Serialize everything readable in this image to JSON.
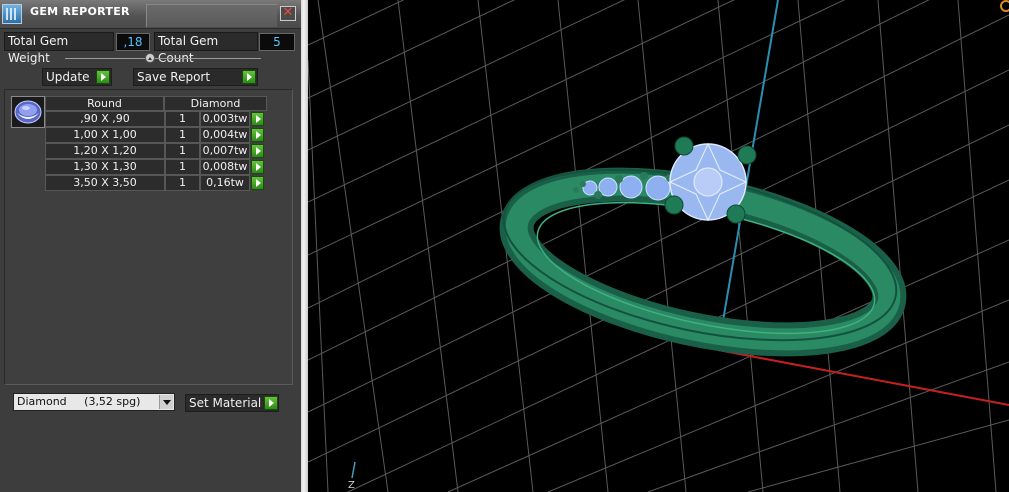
{
  "window": {
    "title": "GEM REPORTER",
    "close_glyph": "✕"
  },
  "totals": {
    "weight_label": "Total Gem Weight",
    "weight_value": ",18",
    "count_label": "Total Gem Count",
    "count_value": "5"
  },
  "actions": {
    "update_label": "Update",
    "save_label": "Save Report"
  },
  "gem_table": {
    "thumbnail_icon": "round-gem-icon",
    "headers": {
      "shape": "Round",
      "material": "Diamond"
    },
    "rows": [
      {
        "size": ",90 X ,90",
        "qty": "1",
        "weight": "0,003tw"
      },
      {
        "size": "1,00 X 1,00",
        "qty": "1",
        "weight": "0,004tw"
      },
      {
        "size": "1,20 X 1,20",
        "qty": "1",
        "weight": "0,007tw"
      },
      {
        "size": "1,30 X 1,30",
        "qty": "1",
        "weight": "0,008tw"
      },
      {
        "size": "3,50 X 3,50",
        "qty": "1",
        "weight": "0,16tw"
      }
    ]
  },
  "material": {
    "selected": "Diamond     (3,52 spg)",
    "set_label": "Set Material"
  },
  "viewport": {
    "axis_label": "Z"
  },
  "colors": {
    "value_text": "#4fc3ff",
    "go_button": "#4caf2a",
    "ring_metal": "#1f6e50",
    "gem": "#9ab8f0",
    "axis_x": "#c42020",
    "axis_z": "#2a8fb0"
  }
}
